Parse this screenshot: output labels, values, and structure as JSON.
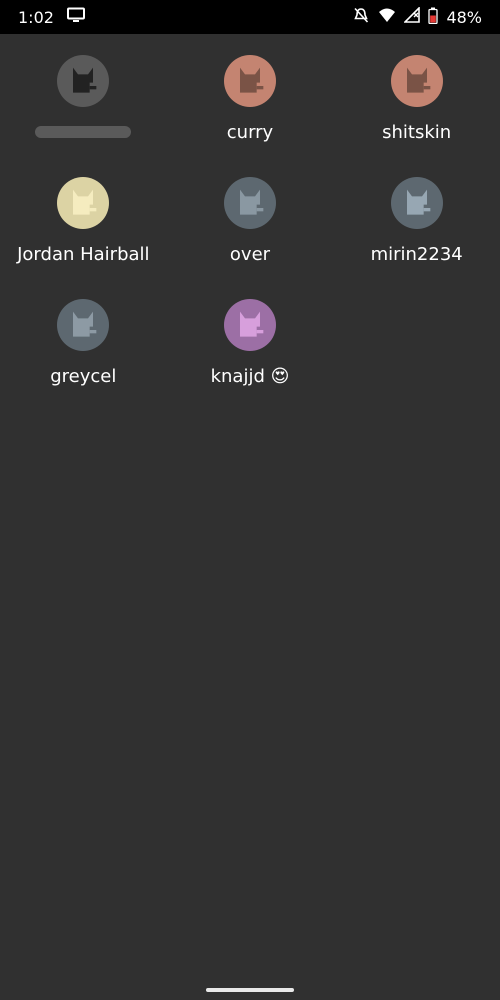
{
  "status_bar": {
    "time": "1:02",
    "battery": "48%"
  },
  "cats": [
    {
      "label": "",
      "avatar_bg": "#5a5a5a",
      "body": "#222222",
      "label_masked": true
    },
    {
      "label": "curry",
      "avatar_bg": "#c48471",
      "body": "#7a5346"
    },
    {
      "label": "shitskin",
      "avatar_bg": "#c48471",
      "body": "#7a5346"
    },
    {
      "label": "Jordan Hairball",
      "avatar_bg": "#dcd3a4",
      "body": "#f5ecbf"
    },
    {
      "label": "over",
      "avatar_bg": "#5d6870",
      "body": "#8a98a2"
    },
    {
      "label": "mirin2234",
      "avatar_bg": "#5d6870",
      "body": "#97a7b3"
    },
    {
      "label": "greycel",
      "avatar_bg": "#5d6870",
      "body": "#8d9aa4"
    },
    {
      "label": "knajjd 😍",
      "avatar_bg": "#9c6fa5",
      "body": "#d79fdc"
    }
  ]
}
